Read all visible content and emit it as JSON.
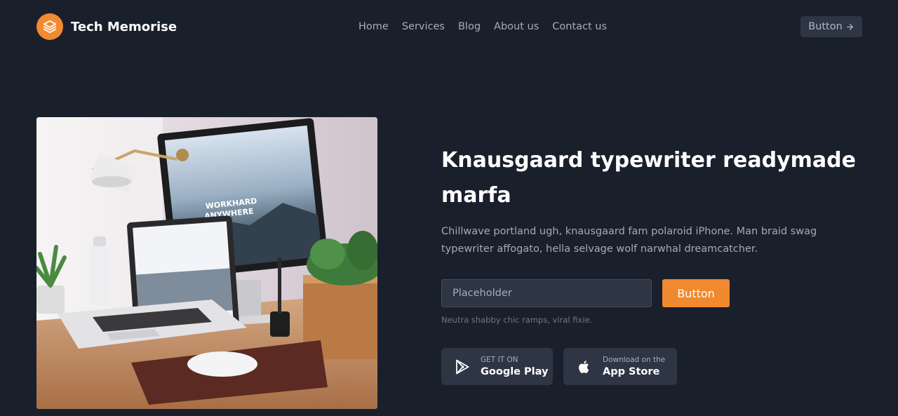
{
  "brand": {
    "name": "Tech Memorise"
  },
  "nav": {
    "items": [
      {
        "label": "Home"
      },
      {
        "label": "Services"
      },
      {
        "label": "Blog"
      },
      {
        "label": "About us"
      },
      {
        "label": "Contact us"
      }
    ]
  },
  "header": {
    "button_label": "Button"
  },
  "hero": {
    "image_icon": "desk-photo",
    "screen_text_line1": "WORKHARD",
    "screen_text_line2": "ANYWHERE",
    "headline": "Knausgaard typewriter readymade marfa",
    "lead": "Chillwave portland ugh, knausgaard fam polaroid iPhone. Man braid swag typewriter affogato, hella selvage wolf narwhal dreamcatcher.",
    "input_placeholder": "Placeholder",
    "button_label": "Button",
    "note": "Neutra shabby chic ramps, viral fixie."
  },
  "stores": {
    "google": {
      "small": "GET IT ON",
      "big": "Google Play",
      "icon": "play-store-icon"
    },
    "apple": {
      "small": "Download on the",
      "big": "App Store",
      "icon": "apple-icon"
    }
  },
  "colors": {
    "background": "#1a1f2c",
    "accent": "#f28a30",
    "surface": "#2e3544"
  }
}
